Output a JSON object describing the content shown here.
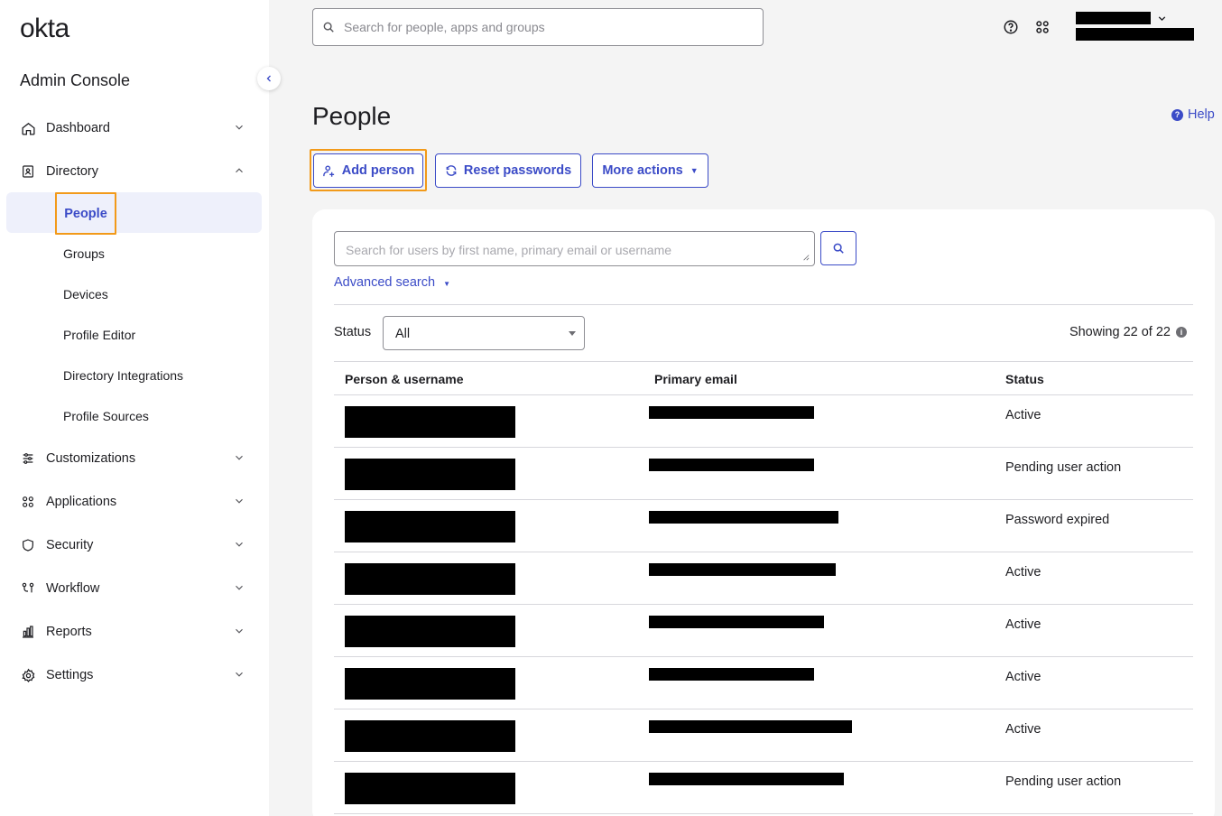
{
  "brand": {
    "logo": "okta",
    "console_title": "Admin Console",
    "accent": "#3b4bc7",
    "highlight": "#f29a1a"
  },
  "sidebar": {
    "items": [
      {
        "label": "Dashboard",
        "icon": "home-icon",
        "expanded": false
      },
      {
        "label": "Directory",
        "icon": "directory-icon",
        "expanded": true,
        "children": [
          "People",
          "Groups",
          "Devices",
          "Profile Editor",
          "Directory Integrations",
          "Profile Sources"
        ]
      },
      {
        "label": "Customizations",
        "icon": "sliders-icon",
        "expanded": false
      },
      {
        "label": "Applications",
        "icon": "apps-grid-icon",
        "expanded": false
      },
      {
        "label": "Security",
        "icon": "shield-icon",
        "expanded": false
      },
      {
        "label": "Workflow",
        "icon": "workflow-icon",
        "expanded": false
      },
      {
        "label": "Reports",
        "icon": "reports-icon",
        "expanded": false
      },
      {
        "label": "Settings",
        "icon": "gear-icon",
        "expanded": false
      }
    ],
    "active_child": "People"
  },
  "topbar": {
    "search_placeholder": "Search for people, apps and groups"
  },
  "page": {
    "title": "People",
    "help": "Help",
    "buttons": {
      "add_person": "Add person",
      "reset_passwords": "Reset passwords",
      "more_actions": "More actions"
    }
  },
  "directory": {
    "search_placeholder": "Search for users by first name, primary email or username",
    "advanced_search": "Advanced search",
    "status_label": "Status",
    "status_value": "All",
    "showing": "Showing 22 of 22",
    "columns": [
      "Person & username",
      "Primary email",
      "Status"
    ],
    "rows": [
      {
        "status": "Active"
      },
      {
        "status": "Pending user action"
      },
      {
        "status": "Password expired"
      },
      {
        "status": "Active"
      },
      {
        "status": "Active"
      },
      {
        "status": "Active"
      },
      {
        "status": "Active"
      },
      {
        "status": "Pending user action"
      }
    ]
  }
}
